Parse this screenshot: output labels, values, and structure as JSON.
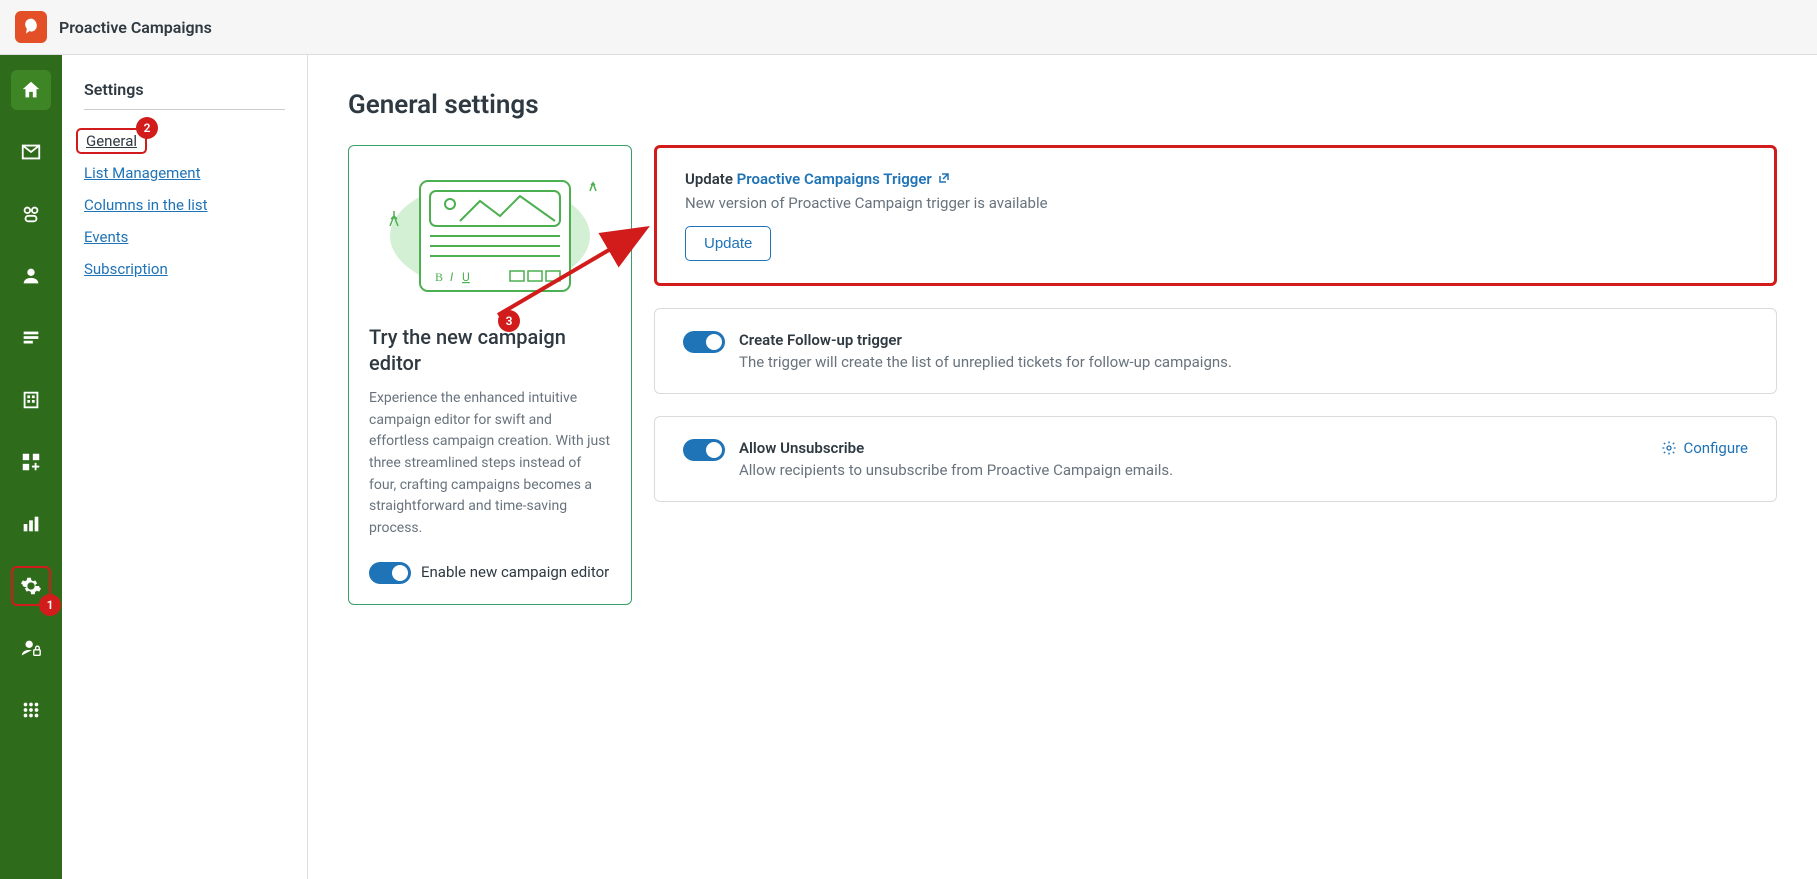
{
  "header": {
    "title": "Proactive Campaigns"
  },
  "sidebar": {
    "title": "Settings",
    "items": [
      {
        "label": "General",
        "active": true
      },
      {
        "label": "List Management"
      },
      {
        "label": "Columns in the list"
      },
      {
        "label": "Events"
      },
      {
        "label": "Subscription"
      }
    ]
  },
  "main": {
    "title": "General settings"
  },
  "promo": {
    "title": "Try the new campaign editor",
    "desc": "Experience the enhanced intuitive campaign editor for swift and effortless campaign creation. With just three streamlined steps instead of four, crafting campaigns becomes a straightforward and time-saving process.",
    "toggle_label": "Enable new campaign editor"
  },
  "update_card": {
    "prefix": "Update ",
    "link_text": "Proactive Campaigns Trigger",
    "desc": "New version of Proactive Campaign trigger is available",
    "button": "Update"
  },
  "followup_card": {
    "title": "Create Follow-up trigger",
    "desc": "The trigger will create the list of unreplied tickets for follow-up campaigns."
  },
  "unsubscribe_card": {
    "title": "Allow Unsubscribe",
    "desc": "Allow recipients to unsubscribe from Proactive Campaign emails.",
    "configure": "Configure"
  },
  "badges": {
    "b1": "1",
    "b2": "2",
    "b3": "3"
  }
}
